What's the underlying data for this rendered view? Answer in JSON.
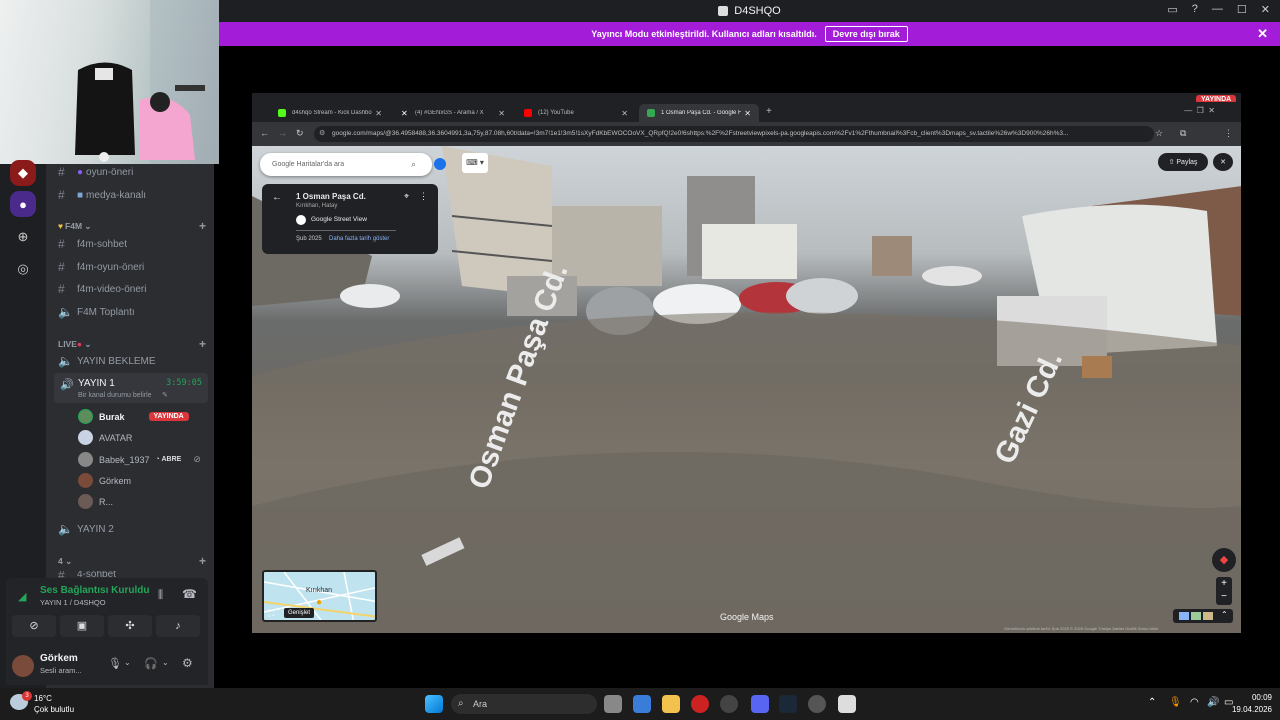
{
  "window": {
    "title": "D4SHQO"
  },
  "banner": {
    "text": "Yayıncı Modu etkinleştirildi. Kullanıcı adları kısaltıldı.",
    "button": "Devre dışı bırak"
  },
  "channels": {
    "top": [
      "oyun-öneri",
      "medya-kanalı"
    ],
    "f4m_category": "F4M",
    "f4m": [
      "f4m-sohbet",
      "f4m-oyun-öneri",
      "f4m-video-öneri",
      "F4M Toplantı"
    ],
    "live_category": "LIVE",
    "voice1": "YAYIN BEKLEME",
    "active_voice": "YAYIN 1",
    "active_timer": "3:59:05",
    "status_hint": "Bir kanal durumu belirle",
    "users": [
      {
        "name": "Burak",
        "badge": "YAYINDA"
      },
      {
        "name": "AVATAR"
      },
      {
        "name": "Babek_1937",
        "tag": "ABRE"
      },
      {
        "name": "Görkem"
      },
      {
        "name": "R..."
      }
    ],
    "voice2": "YAYIN 2",
    "cat4": "4",
    "cut_channel": "4-sohbet"
  },
  "voice_panel": {
    "status": "Ses Bağlantısı Kuruldu",
    "channel": "YAYIN 1 / D4SHQO",
    "user_name": "Görkem",
    "user_status": "Sesli aram..."
  },
  "stream": {
    "live_badge": "YAYINDA",
    "tabs": [
      {
        "label": "d4shqo Stream - Kick Dashboard",
        "color": "#53fc18"
      },
      {
        "label": "(4) #GENxGS - Arama / X",
        "color": "#ffffff"
      },
      {
        "label": "(12) YouTube",
        "color": "#ff0000"
      },
      {
        "label": "1 Osman Paşa Cd. - Google Haritalar",
        "color": "#34a853"
      }
    ],
    "url": "google.com/maps/@36.4958488,36.3604991,3a,75y,87.08h,60t/data=!3m7!1e1!3m5!1sXyFdKbEWOCOoVX_QRpfQ!2e0!6shttps:%2F%2Fstreetviewpixels-pa.googleapis.com%2Fv1%2Fthumbnail%3Fcb_client%3Dmaps_sv.tactile%26w%3D900%26h%3...",
    "search_placeholder": "Google Haritalar'da ara",
    "place_title": "1 Osman Paşa Cd.",
    "place_sub": "Kırıkhan, Hatay",
    "provider": "Google Street View",
    "date": "Şub 2025",
    "more_dates": "Daha fazla tarih göster",
    "share": "Paylaş",
    "street1": "Osman Paşa Cd.",
    "street2": "Gazi Cd.",
    "watermark": "Google Maps",
    "minimap_label": "Kırıkhan",
    "expand": "Genişlet",
    "footer": "Görüntünün çekilme tarihi: Şub 2025   © 2026 Google   Türkiye   Şartlar   Gizlilik   Sorun bildir"
  },
  "taskbar": {
    "temp": "16°C",
    "weather": "Çok bulutlu",
    "search": "Ara",
    "time": "00:09",
    "date": "19.04.2026",
    "notif_count": "3"
  }
}
